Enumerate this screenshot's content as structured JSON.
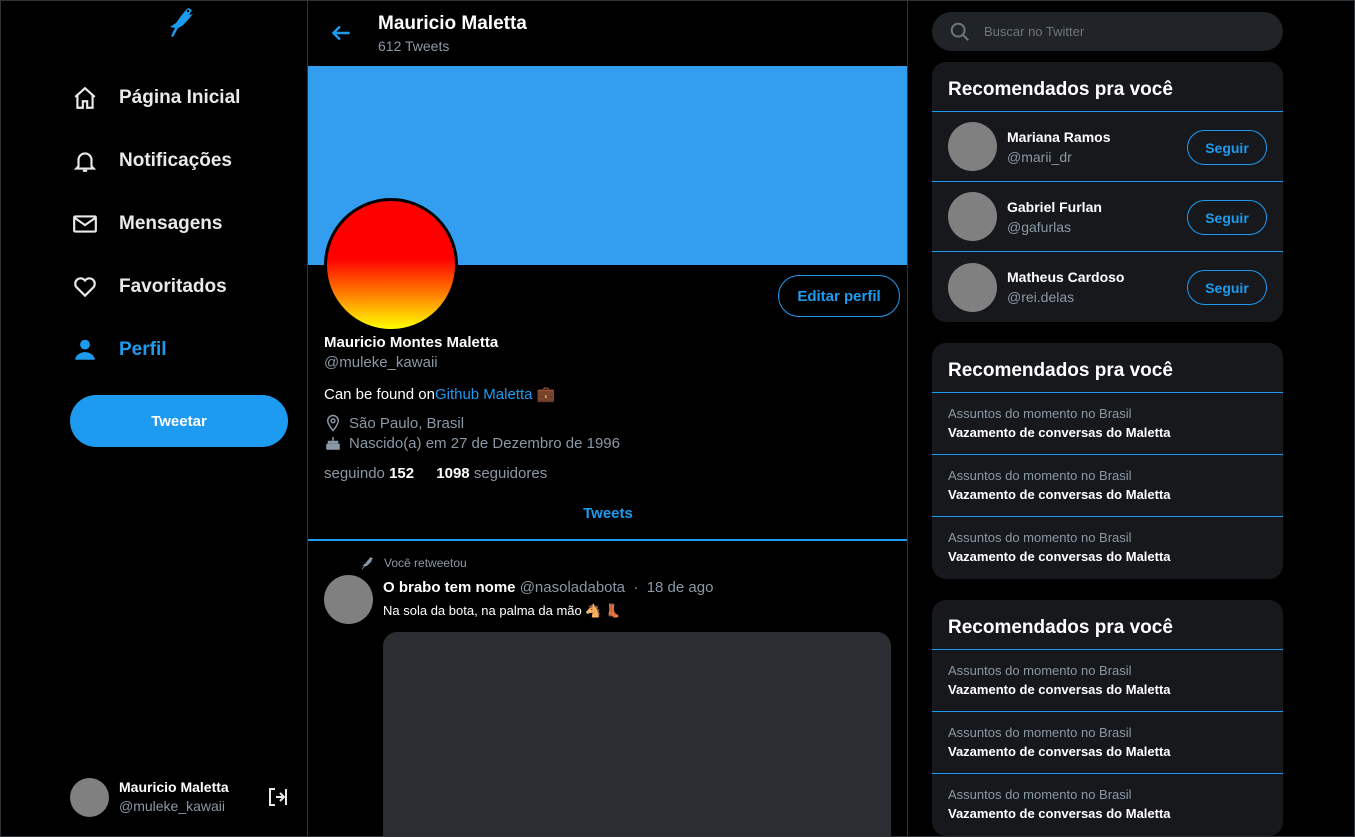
{
  "colors": {
    "accent": "#1d9bf0",
    "banner": "#339ef0",
    "card": "#16181c",
    "muted": "#8b98a5"
  },
  "sidebar": {
    "logo_icon": "parrot-logo-icon",
    "items": [
      {
        "label": "Página Inicial",
        "icon": "home-icon"
      },
      {
        "label": "Notificações",
        "icon": "bell-icon"
      },
      {
        "label": "Mensagens",
        "icon": "mail-icon"
      },
      {
        "label": "Favoritados",
        "icon": "heart-icon"
      },
      {
        "label": "Perfil",
        "icon": "user-icon",
        "active": true
      }
    ],
    "tweet_button": "Tweetar",
    "account": {
      "name": "Mauricio Maletta",
      "handle": "@muleke_kawaii",
      "logout_icon": "logout-icon"
    }
  },
  "header": {
    "title": "Mauricio Maletta",
    "tweet_count": "612 Tweets"
  },
  "profile": {
    "edit_button": "Editar perfil",
    "name": "Mauricio Montes Maletta",
    "handle": "@muleke_kawaii",
    "bio_prefix": "Can be found on",
    "bio_link": "Github Maletta",
    "bio_emoji": "💼",
    "location": "São Paulo, Brasil",
    "birth": "Nascido(a) em 27 de Dezembro de 1996",
    "following_label": "seguindo",
    "following_count": "152",
    "followers_count": "1098",
    "followers_label": "seguidores"
  },
  "tabs": {
    "active": "Tweets"
  },
  "tweet": {
    "retweet_label": "Você retweetou",
    "author": "O brabo tem nome",
    "handle": "@nasoladabota",
    "separator": "·",
    "date": "18 de ago",
    "text": "Na sola da bota, na palma da mão 🐴 👢"
  },
  "search": {
    "placeholder": "Buscar no Twitter"
  },
  "who_to_follow": {
    "title": "Recomendados pra você",
    "follow_label": "Seguir",
    "users": [
      {
        "name": "Mariana Ramos",
        "handle": "@marii_dr"
      },
      {
        "name": "Gabriel Furlan",
        "handle": "@gafurlas"
      },
      {
        "name": "Matheus Cardoso",
        "handle": "@rei.delas"
      }
    ]
  },
  "trends_1": {
    "title": "Recomendados pra você",
    "items": [
      {
        "context": "Assuntos do momento no Brasil",
        "topic": "Vazamento de conversas do Maletta"
      },
      {
        "context": "Assuntos do momento no Brasil",
        "topic": "Vazamento de conversas do Maletta"
      },
      {
        "context": "Assuntos do momento no Brasil",
        "topic": "Vazamento de conversas do Maletta"
      }
    ]
  },
  "trends_2": {
    "title": "Recomendados pra você",
    "items": [
      {
        "context": "Assuntos do momento no Brasil",
        "topic": "Vazamento de conversas do Maletta"
      },
      {
        "context": "Assuntos do momento no Brasil",
        "topic": "Vazamento de conversas do Maletta"
      },
      {
        "context": "Assuntos do momento no Brasil",
        "topic": "Vazamento de conversas do Maletta"
      }
    ]
  }
}
